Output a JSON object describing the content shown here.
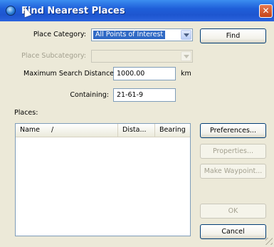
{
  "window": {
    "title": "Find Nearest Places",
    "close_glyph": "✕"
  },
  "form": {
    "place_category": {
      "label": "Place Category:",
      "value": "All Points of Interest"
    },
    "place_subcategory": {
      "label": "Place Subcategory:",
      "value": ""
    },
    "max_distance": {
      "label": "Maximum Search Distance:",
      "value": "1000.00",
      "unit": "km"
    },
    "containing": {
      "label": "Containing:",
      "value": "21-61-9"
    }
  },
  "places": {
    "label": "Places:",
    "columns": [
      {
        "label": "Name",
        "sort": "/"
      },
      {
        "label": "Dista..."
      },
      {
        "label": "Bearing"
      }
    ],
    "rows": []
  },
  "buttons": {
    "find": "Find",
    "preferences": "Preferences...",
    "properties": "Properties...",
    "make_waypoint": "Make Waypoint...",
    "ok": "OK",
    "cancel": "Cancel"
  },
  "colors": {
    "titlebar": "#1f5fd9",
    "selection": "#316ac5",
    "dialog_bg": "#ece9d8"
  },
  "icons": [
    "app-globe-icon",
    "close-icon",
    "dropdown-arrow-icon",
    "resize-grip-icon"
  ]
}
